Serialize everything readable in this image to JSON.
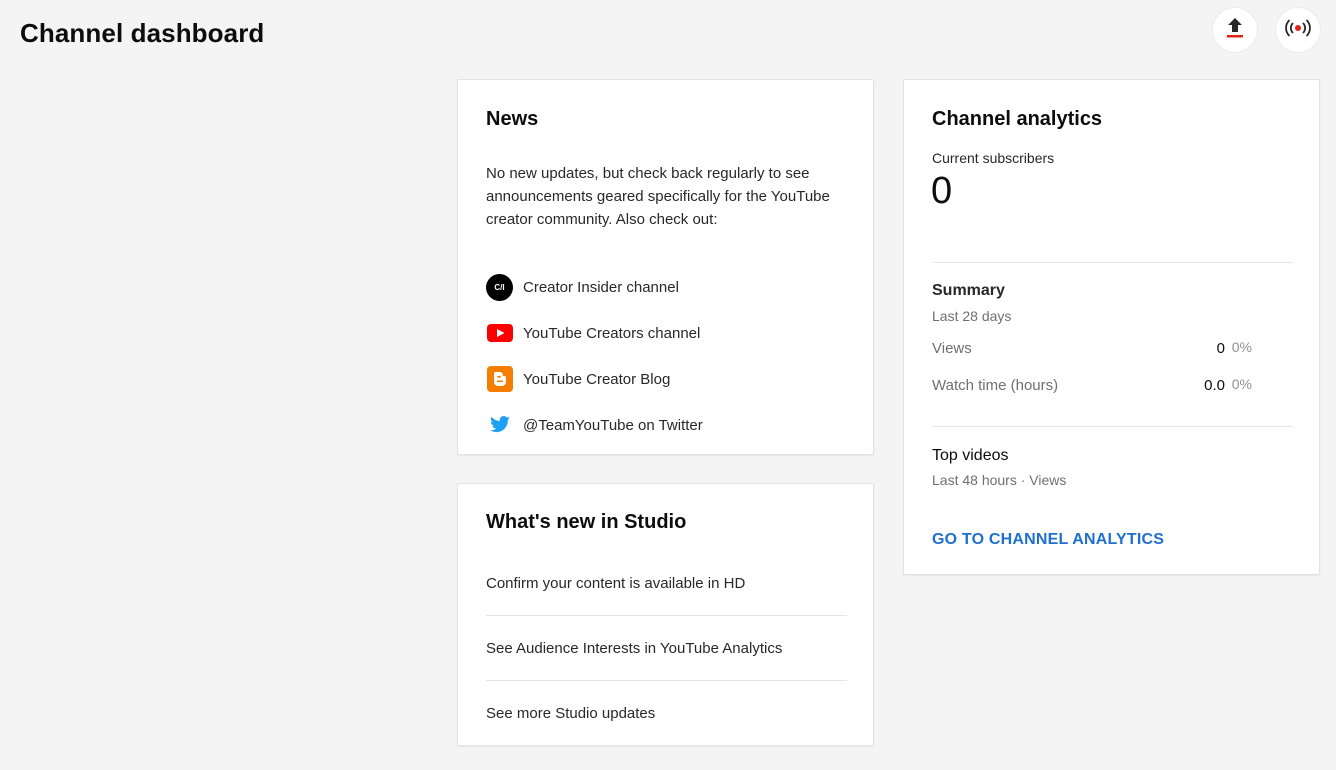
{
  "page": {
    "title": "Channel dashboard"
  },
  "header_actions": {
    "upload": {
      "icon": "upload-icon"
    },
    "live": {
      "icon": "live-broadcast-icon"
    }
  },
  "news": {
    "title": "News",
    "body": "No new updates, but check back regularly to see announcements geared specifically for the YouTube creator community. Also check out:",
    "links": [
      {
        "label": "Creator Insider channel",
        "icon": "creator-insider-icon",
        "icon_text": "C/I"
      },
      {
        "label": "YouTube Creators channel",
        "icon": "youtube-icon"
      },
      {
        "label": "YouTube Creator Blog",
        "icon": "blogger-icon"
      },
      {
        "label": "@TeamYouTube on Twitter",
        "icon": "twitter-icon"
      }
    ]
  },
  "studio": {
    "title": "What's new in Studio",
    "items": [
      "Confirm your content is available in HD",
      "See Audience Interests in YouTube Analytics",
      "See more Studio updates"
    ]
  },
  "analytics": {
    "title": "Channel analytics",
    "subscribers_label": "Current subscribers",
    "subscribers_value": "0",
    "summary": {
      "title": "Summary",
      "period": "Last 28 days",
      "metrics": [
        {
          "label": "Views",
          "value": "0",
          "change": "0%"
        },
        {
          "label": "Watch time (hours)",
          "value": "0.0",
          "change": "0%"
        }
      ]
    },
    "top_videos": {
      "title": "Top videos",
      "subtitle": "Last 48 hours · Views"
    },
    "cta": "GO TO CHANNEL ANALYTICS"
  },
  "colors": {
    "accent_link": "#1f6fd1",
    "youtube_red": "#ff0000",
    "blogger_orange": "#f57d00",
    "twitter_blue": "#1da1f2",
    "live_red": "#e62117"
  }
}
